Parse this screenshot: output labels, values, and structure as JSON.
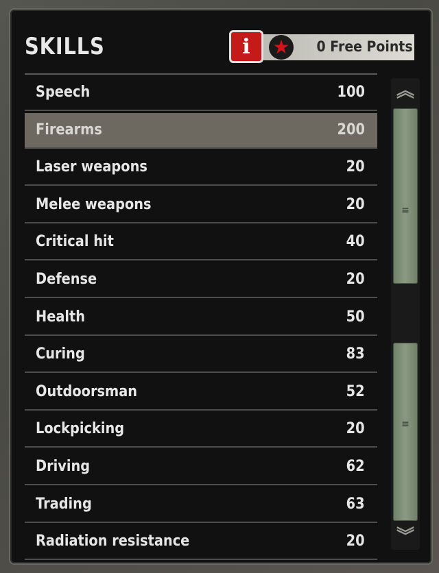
{
  "window": {
    "title": "SKILLS"
  },
  "header": {
    "info_label": "i",
    "free_points": "0 Free Points",
    "star_glyph": "★"
  },
  "skills": [
    {
      "name": "Speech",
      "value": "100"
    },
    {
      "name": "Firearms",
      "value": "200",
      "selected": true
    },
    {
      "name": "Laser weapons",
      "value": "20"
    },
    {
      "name": "Melee weapons",
      "value": "20"
    },
    {
      "name": "Critical hit",
      "value": "40"
    },
    {
      "name": "Defense",
      "value": "20"
    },
    {
      "name": "Health",
      "value": "50"
    },
    {
      "name": "Curing",
      "value": "83"
    },
    {
      "name": "Outdoorsman",
      "value": "52"
    },
    {
      "name": "Lockpicking",
      "value": "20"
    },
    {
      "name": "Driving",
      "value": "62"
    },
    {
      "name": "Trading",
      "value": "63"
    },
    {
      "name": "Radiation resistance",
      "value": "20"
    }
  ],
  "scrollbar": {
    "up_icon": "chevron-double-up-icon",
    "down_icon": "chevron-double-down-icon"
  },
  "colors": {
    "accent_red": "#c41a1a",
    "selected_row": "#6d6860",
    "thumb": "#8a9a82"
  }
}
